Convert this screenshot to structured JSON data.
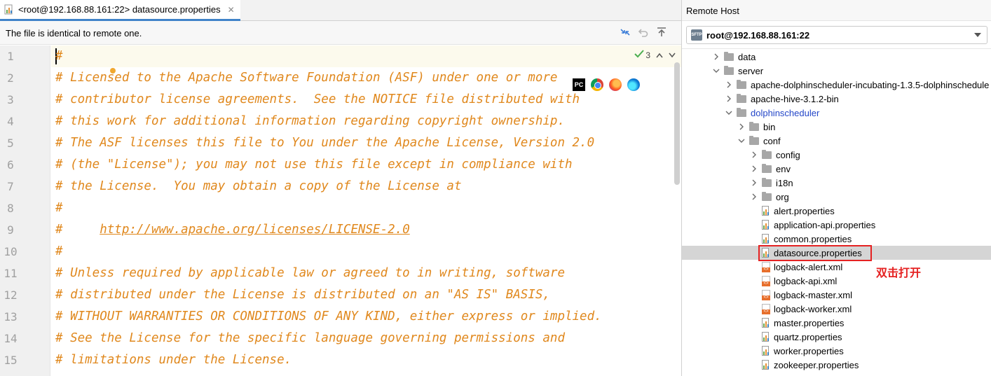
{
  "editor": {
    "tab_title": "<root@192.168.88.161:22> datasource.properties",
    "info_bar_text": "The file is identical to remote one.",
    "inspection_count": "3",
    "lines": [
      {
        "num": "1",
        "text": "#"
      },
      {
        "num": "2",
        "text": "# Licensed to the Apache Software Foundation (ASF) under one or more"
      },
      {
        "num": "3",
        "text": "# contributor license agreements.  See the NOTICE file distributed with"
      },
      {
        "num": "4",
        "text": "# this work for additional information regarding copyright ownership."
      },
      {
        "num": "5",
        "text": "# The ASF licenses this file to You under the Apache License, Version 2.0"
      },
      {
        "num": "6",
        "text": "# (the \"License\"); you may not use this file except in compliance with"
      },
      {
        "num": "7",
        "text": "# the License.  You may obtain a copy of the License at"
      },
      {
        "num": "8",
        "text": "#"
      },
      {
        "num": "9",
        "text_prefix": "#     ",
        "link": "http://www.apache.org/licenses/LICENSE-2.0"
      },
      {
        "num": "10",
        "text": "#"
      },
      {
        "num": "11",
        "text": "# Unless required by applicable law or agreed to in writing, software"
      },
      {
        "num": "12",
        "text": "# distributed under the License is distributed on an \"AS IS\" BASIS,"
      },
      {
        "num": "13",
        "text": "# WITHOUT WARRANTIES OR CONDITIONS OF ANY KIND, either express or implied."
      },
      {
        "num": "14",
        "text": "# See the License for the specific language governing permissions and"
      },
      {
        "num": "15",
        "text": "# limitations under the License."
      }
    ],
    "browser_icons": [
      "pycharm-icon",
      "chrome-icon",
      "firefox-icon",
      "edge-icon"
    ],
    "comment_color": "#e0881d"
  },
  "remote": {
    "title": "Remote Host",
    "host": "root@192.168.88.161:22",
    "tree": [
      {
        "label": "data",
        "kind": "folder",
        "level": 0,
        "state": "collapsed"
      },
      {
        "label": "server",
        "kind": "folder",
        "level": 0,
        "state": "expanded"
      },
      {
        "label": "apache-dolphinscheduler-incubating-1.3.5-dolphinschedule",
        "kind": "folder",
        "level": 1,
        "state": "collapsed"
      },
      {
        "label": "apache-hive-3.1.2-bin",
        "kind": "folder",
        "level": 1,
        "state": "collapsed"
      },
      {
        "label": "dolphinscheduler",
        "kind": "folder",
        "level": 1,
        "state": "expanded",
        "link": true
      },
      {
        "label": "bin",
        "kind": "folder",
        "level": 2,
        "state": "collapsed"
      },
      {
        "label": "conf",
        "kind": "folder",
        "level": 2,
        "state": "expanded"
      },
      {
        "label": "config",
        "kind": "folder",
        "level": 3,
        "state": "collapsed"
      },
      {
        "label": "env",
        "kind": "folder",
        "level": 3,
        "state": "collapsed"
      },
      {
        "label": "i18n",
        "kind": "folder",
        "level": 3,
        "state": "collapsed"
      },
      {
        "label": "org",
        "kind": "folder",
        "level": 3,
        "state": "collapsed"
      },
      {
        "label": "alert.properties",
        "kind": "properties",
        "level": 3
      },
      {
        "label": "application-api.properties",
        "kind": "properties",
        "level": 3
      },
      {
        "label": "common.properties",
        "kind": "properties",
        "level": 3
      },
      {
        "label": "datasource.properties",
        "kind": "properties",
        "level": 3,
        "selected": true
      },
      {
        "label": "logback-alert.xml",
        "kind": "xml",
        "level": 3
      },
      {
        "label": "logback-api.xml",
        "kind": "xml",
        "level": 3
      },
      {
        "label": "logback-master.xml",
        "kind": "xml",
        "level": 3
      },
      {
        "label": "logback-worker.xml",
        "kind": "xml",
        "level": 3
      },
      {
        "label": "master.properties",
        "kind": "properties",
        "level": 3
      },
      {
        "label": "quartz.properties",
        "kind": "properties",
        "level": 3
      },
      {
        "label": "worker.properties",
        "kind": "properties",
        "level": 3
      },
      {
        "label": "zookeeper.properties",
        "kind": "properties",
        "level": 3
      }
    ],
    "annotation": "双击打开",
    "highlight_color": "#e52222"
  }
}
